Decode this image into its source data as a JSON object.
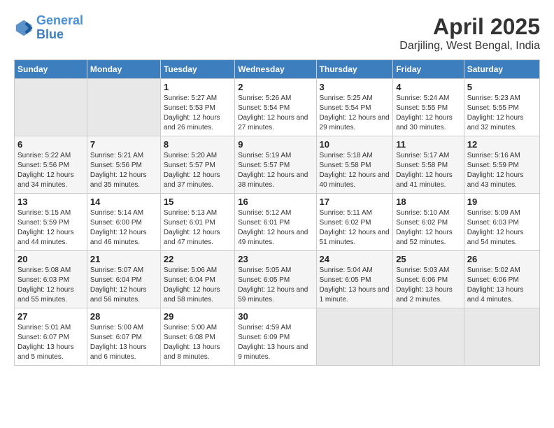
{
  "header": {
    "logo_line1": "General",
    "logo_line2": "Blue",
    "title": "April 2025",
    "subtitle": "Darjiling, West Bengal, India"
  },
  "calendar": {
    "days_of_week": [
      "Sunday",
      "Monday",
      "Tuesday",
      "Wednesday",
      "Thursday",
      "Friday",
      "Saturday"
    ],
    "weeks": [
      [
        {
          "day": "",
          "empty": true
        },
        {
          "day": "",
          "empty": true
        },
        {
          "day": "1",
          "sunrise": "5:27 AM",
          "sunset": "5:53 PM",
          "daylight": "12 hours and 26 minutes."
        },
        {
          "day": "2",
          "sunrise": "5:26 AM",
          "sunset": "5:54 PM",
          "daylight": "12 hours and 27 minutes."
        },
        {
          "day": "3",
          "sunrise": "5:25 AM",
          "sunset": "5:54 PM",
          "daylight": "12 hours and 29 minutes."
        },
        {
          "day": "4",
          "sunrise": "5:24 AM",
          "sunset": "5:55 PM",
          "daylight": "12 hours and 30 minutes."
        },
        {
          "day": "5",
          "sunrise": "5:23 AM",
          "sunset": "5:55 PM",
          "daylight": "12 hours and 32 minutes."
        }
      ],
      [
        {
          "day": "6",
          "sunrise": "5:22 AM",
          "sunset": "5:56 PM",
          "daylight": "12 hours and 34 minutes."
        },
        {
          "day": "7",
          "sunrise": "5:21 AM",
          "sunset": "5:56 PM",
          "daylight": "12 hours and 35 minutes."
        },
        {
          "day": "8",
          "sunrise": "5:20 AM",
          "sunset": "5:57 PM",
          "daylight": "12 hours and 37 minutes."
        },
        {
          "day": "9",
          "sunrise": "5:19 AM",
          "sunset": "5:57 PM",
          "daylight": "12 hours and 38 minutes."
        },
        {
          "day": "10",
          "sunrise": "5:18 AM",
          "sunset": "5:58 PM",
          "daylight": "12 hours and 40 minutes."
        },
        {
          "day": "11",
          "sunrise": "5:17 AM",
          "sunset": "5:58 PM",
          "daylight": "12 hours and 41 minutes."
        },
        {
          "day": "12",
          "sunrise": "5:16 AM",
          "sunset": "5:59 PM",
          "daylight": "12 hours and 43 minutes."
        }
      ],
      [
        {
          "day": "13",
          "sunrise": "5:15 AM",
          "sunset": "5:59 PM",
          "daylight": "12 hours and 44 minutes."
        },
        {
          "day": "14",
          "sunrise": "5:14 AM",
          "sunset": "6:00 PM",
          "daylight": "12 hours and 46 minutes."
        },
        {
          "day": "15",
          "sunrise": "5:13 AM",
          "sunset": "6:01 PM",
          "daylight": "12 hours and 47 minutes."
        },
        {
          "day": "16",
          "sunrise": "5:12 AM",
          "sunset": "6:01 PM",
          "daylight": "12 hours and 49 minutes."
        },
        {
          "day": "17",
          "sunrise": "5:11 AM",
          "sunset": "6:02 PM",
          "daylight": "12 hours and 51 minutes."
        },
        {
          "day": "18",
          "sunrise": "5:10 AM",
          "sunset": "6:02 PM",
          "daylight": "12 hours and 52 minutes."
        },
        {
          "day": "19",
          "sunrise": "5:09 AM",
          "sunset": "6:03 PM",
          "daylight": "12 hours and 54 minutes."
        }
      ],
      [
        {
          "day": "20",
          "sunrise": "5:08 AM",
          "sunset": "6:03 PM",
          "daylight": "12 hours and 55 minutes."
        },
        {
          "day": "21",
          "sunrise": "5:07 AM",
          "sunset": "6:04 PM",
          "daylight": "12 hours and 56 minutes."
        },
        {
          "day": "22",
          "sunrise": "5:06 AM",
          "sunset": "6:04 PM",
          "daylight": "12 hours and 58 minutes."
        },
        {
          "day": "23",
          "sunrise": "5:05 AM",
          "sunset": "6:05 PM",
          "daylight": "12 hours and 59 minutes."
        },
        {
          "day": "24",
          "sunrise": "5:04 AM",
          "sunset": "6:05 PM",
          "daylight": "13 hours and 1 minute."
        },
        {
          "day": "25",
          "sunrise": "5:03 AM",
          "sunset": "6:06 PM",
          "daylight": "13 hours and 2 minutes."
        },
        {
          "day": "26",
          "sunrise": "5:02 AM",
          "sunset": "6:06 PM",
          "daylight": "13 hours and 4 minutes."
        }
      ],
      [
        {
          "day": "27",
          "sunrise": "5:01 AM",
          "sunset": "6:07 PM",
          "daylight": "13 hours and 5 minutes."
        },
        {
          "day": "28",
          "sunrise": "5:00 AM",
          "sunset": "6:07 PM",
          "daylight": "13 hours and 6 minutes."
        },
        {
          "day": "29",
          "sunrise": "5:00 AM",
          "sunset": "6:08 PM",
          "daylight": "13 hours and 8 minutes."
        },
        {
          "day": "30",
          "sunrise": "4:59 AM",
          "sunset": "6:09 PM",
          "daylight": "13 hours and 9 minutes."
        },
        {
          "day": "",
          "empty": true
        },
        {
          "day": "",
          "empty": true
        },
        {
          "day": "",
          "empty": true
        }
      ]
    ]
  },
  "labels": {
    "sunrise_prefix": "Sunrise: ",
    "sunset_prefix": "Sunset: ",
    "daylight_prefix": "Daylight: "
  }
}
